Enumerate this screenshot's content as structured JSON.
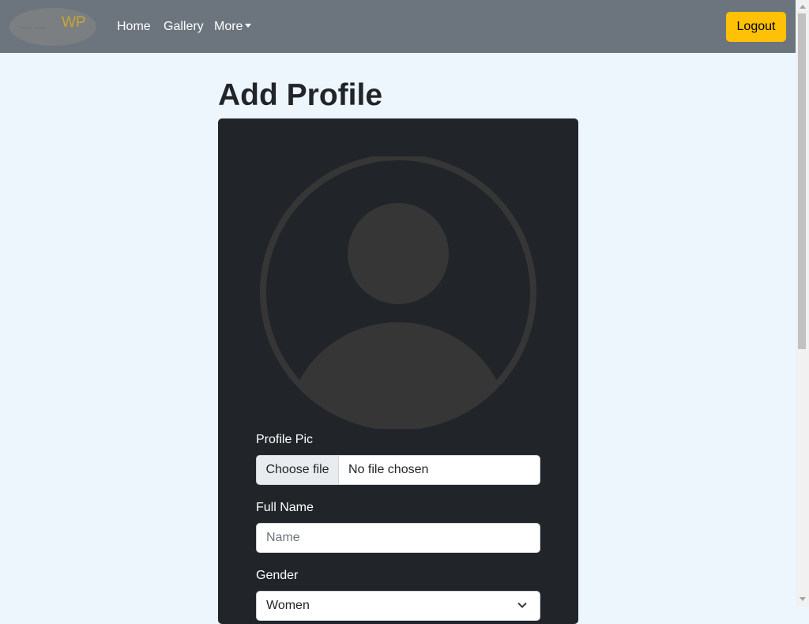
{
  "navbar": {
    "brand_text": "WP",
    "links": [
      {
        "label": "Home"
      },
      {
        "label": "Gallery"
      },
      {
        "label": "More"
      }
    ],
    "logout_label": "Logout"
  },
  "page": {
    "title": "Add Profile"
  },
  "form": {
    "profile_pic_label": "Profile Pic",
    "file_button_label": "Choose file",
    "file_status": "No file chosen",
    "full_name_label": "Full Name",
    "full_name_placeholder": "Name",
    "full_name_value": "",
    "gender_label": "Gender",
    "gender_selected": "Women"
  },
  "icons": {
    "avatar": "user-avatar-placeholder-icon",
    "dropdown": "chevron-down-icon",
    "more_caret": "caret-down-icon"
  },
  "colors": {
    "navbar_bg": "#6c757d",
    "page_bg": "#eef6fd",
    "card_bg": "#212529",
    "logout_bg": "#ffc107",
    "avatar_fill": "#363636",
    "brand_text": "#c8a632"
  }
}
